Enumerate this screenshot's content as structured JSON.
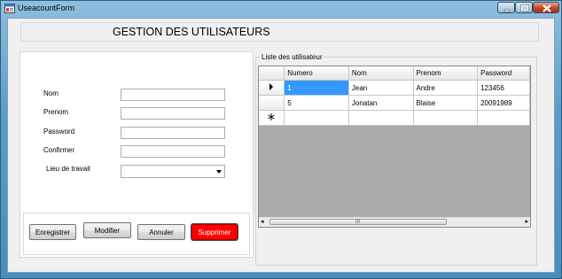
{
  "window": {
    "title": "UseacountForm"
  },
  "header": {
    "title": "GESTION DES UTILISATEURS"
  },
  "form": {
    "nom_label": "Nom",
    "prenom_label": "Prenom",
    "password_label": "Password",
    "confirmer_label": "Confirmer",
    "lieu_label": "Lieu de travail",
    "nom_value": "",
    "prenom_value": "",
    "password_value": "",
    "confirmer_value": "",
    "lieu_value": ""
  },
  "buttons": {
    "enregistrer": "Enregistrer",
    "modifier": "Modifier",
    "annuler": "Annuler",
    "supprimer": "Supprimer"
  },
  "list": {
    "title": "Liste des utilisateur",
    "columns": [
      "Numero",
      "Nom",
      "Prenom",
      "Password"
    ],
    "rows": [
      [
        "1",
        "Jean",
        "Andre",
        "123456"
      ],
      [
        "5",
        "Jonatan",
        "Blaise",
        "20091989"
      ]
    ],
    "scroll_grip": "III"
  },
  "colors": {
    "delete_button": "#ff0000",
    "selection": "#3399ff"
  }
}
